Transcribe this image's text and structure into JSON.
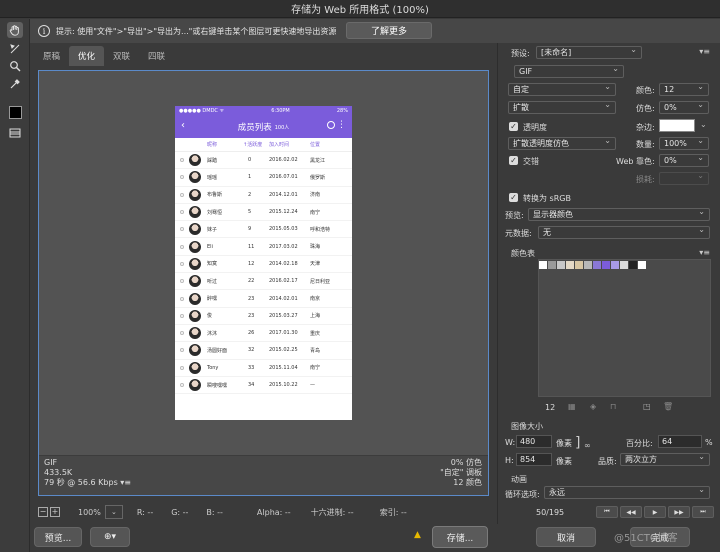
{
  "window": {
    "title": "存储为 Web 所用格式 (100%)"
  },
  "infobar": {
    "text": "提示: 使用\"文件\">\"导出\">\"导出为...\"或右键单击某个图层可更快速地导出资源",
    "learn_more": "了解更多"
  },
  "tabs": [
    "原稿",
    "优化",
    "双联",
    "四联"
  ],
  "canvas_info": {
    "format": "GIF",
    "size": "433.5K",
    "time": "79 秒 @ 56.6 Kbps",
    "dither": "0% 仿色",
    "palette": "\"自定\" 调板",
    "colors": "12 颜色"
  },
  "phone": {
    "status_left": "●●●●● DMDC ᯤ",
    "status_time": "6:30PM",
    "status_right": "28%",
    "title": "成员列表",
    "count": "100人",
    "col_name": "昵称",
    "col_rank": "↑活跃度",
    "col_date": "加入时间",
    "col_loc": "位置",
    "rows": [
      {
        "name": "踩踏",
        "rank": "0",
        "date": "2016.02.02",
        "loc": "黑龙江"
      },
      {
        "name": "瑶瑶",
        "rank": "1",
        "date": "2016.07.01",
        "loc": "俄罗斯"
      },
      {
        "name": "布鲁斯",
        "rank": "2",
        "date": "2014.12.01",
        "loc": "济南"
      },
      {
        "name": "刘骞恒",
        "rank": "5",
        "date": "2015.12.24",
        "loc": "南宁"
      },
      {
        "name": "妹子",
        "rank": "9",
        "date": "2015.05.03",
        "loc": "呼和浩特"
      },
      {
        "name": "Eli",
        "rank": "11",
        "date": "2017.03.02",
        "loc": "珠海"
      },
      {
        "name": "知寞",
        "rank": "12",
        "date": "2014.02.18",
        "loc": "天津"
      },
      {
        "name": "听过",
        "rank": "22",
        "date": "2016.02.17",
        "loc": "尼日利亚"
      },
      {
        "name": "醉嘿",
        "rank": "23",
        "date": "2014.02.01",
        "loc": "南京"
      },
      {
        "name": "俊",
        "rank": "23",
        "date": "2015.03.27",
        "loc": "上海"
      },
      {
        "name": "沐沐",
        "rank": "26",
        "date": "2017.01.30",
        "loc": "重庆"
      },
      {
        "name": "汤圆好面",
        "rank": "32",
        "date": "2015.02.25",
        "loc": "青岛"
      },
      {
        "name": "Tony",
        "rank": "33",
        "date": "2015.11.04",
        "loc": "南宁"
      },
      {
        "name": "瞬嗖嘿嘿",
        "rank": "34",
        "date": "2015.10.22",
        "loc": "—"
      }
    ]
  },
  "bottom_bar": {
    "zoom": "100%",
    "r": "R: --",
    "g": "G: --",
    "b": "B: --",
    "alpha": "Alpha: --",
    "hex": "十六进制: --",
    "index": "索引: --"
  },
  "footer": {
    "preview": "预览...",
    "save": "存储...",
    "cancel": "取消",
    "done": "完成",
    "watermark": "@51CTO博客"
  },
  "panel": {
    "preset_label": "预设:",
    "preset_value": "[未命名]",
    "format": "GIF",
    "reduction": "自定",
    "colors_label": "颜色:",
    "colors_value": "12",
    "dither_algo": "扩散",
    "dither_label": "仿色:",
    "dither_value": "0%",
    "transparency": "透明度",
    "matte_label": "杂边:",
    "trans_dither": "扩散透明度仿色",
    "amount_label": "数量:",
    "amount_value": "100%",
    "interlaced": "交错",
    "web_snap_label": "Web 靠色:",
    "web_snap_value": "0%",
    "lossy_label": "损耗:",
    "convert_srgb": "转换为 sRGB",
    "preview_label": "预览:",
    "preview_value": "显示器颜色",
    "metadata_label": "元数据:",
    "metadata_value": "无",
    "color_table_label": "颜色表",
    "color_count": "12",
    "palette": [
      "#ffffff",
      "#9a9a9a",
      "#c8c8c8",
      "#e4d9c6",
      "#d8c6a3",
      "#b8b8b8",
      "#8a78d6",
      "#7b5cdb",
      "#a89ae6",
      "#dcdcdc",
      "#222222",
      "#ffffff"
    ],
    "image_size_label": "图像大小",
    "w_label": "W:",
    "w_value": "480",
    "h_label": "H:",
    "h_value": "854",
    "px_unit": "像素",
    "percent_label": "百分比:",
    "percent_value": "64",
    "percent_unit": "%",
    "quality_label": "品质:",
    "quality_value": "两次立方",
    "animation_label": "动画",
    "loop_label": "循环选项:",
    "loop_value": "永远",
    "frame_counter": "50/195"
  }
}
